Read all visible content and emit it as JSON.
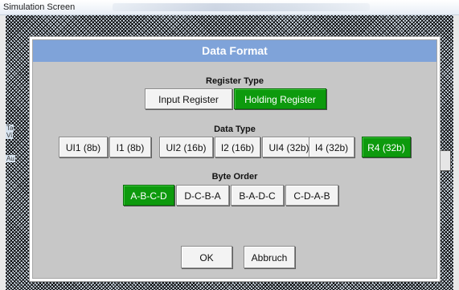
{
  "window": {
    "title": "Simulation Screen"
  },
  "background": {
    "hint_1": "Ta",
    "hint_2": "Vi",
    "hint_3": "Au"
  },
  "dialog": {
    "title": "Data Format",
    "register_type": {
      "label": "Register Type",
      "options": [
        "Input Register",
        "Holding Register"
      ],
      "selected": "Holding Register"
    },
    "data_type": {
      "label": "Data Type",
      "options": [
        "UI1 (8b)",
        "I1 (8b)",
        "UI2 (16b)",
        "I2 (16b)",
        "UI4 (32b)",
        "I4 (32b)",
        "R4 (32b)"
      ],
      "selected": "R4 (32b)"
    },
    "byte_order": {
      "label": "Byte Order",
      "options": [
        "A-B-C-D",
        "D-C-B-A",
        "B-A-D-C",
        "C-D-A-B"
      ],
      "selected": "A-B-C-D"
    },
    "ok_label": "OK",
    "cancel_label": "Abbruch"
  },
  "colors": {
    "header": "#7fa3d9",
    "selected": "#0d9a0d",
    "panel": "#c7c7c7"
  }
}
